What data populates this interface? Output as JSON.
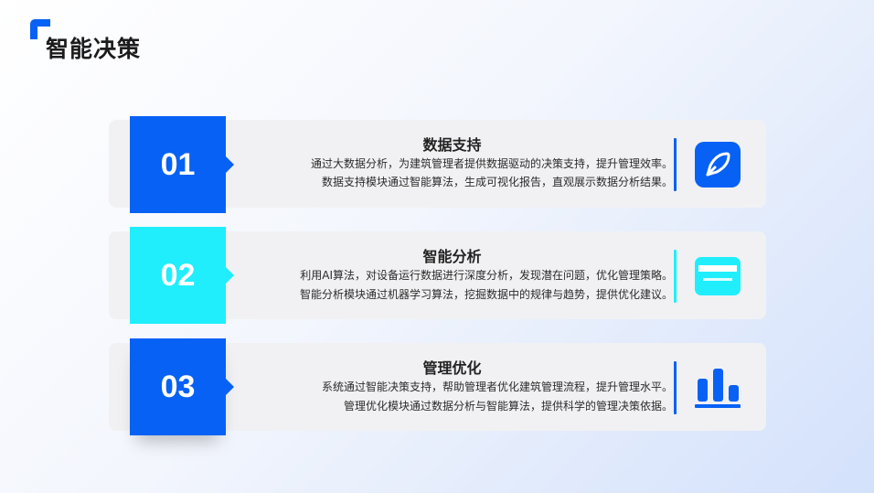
{
  "header": {
    "title": "智能决策"
  },
  "colors": {
    "blue": "#0761f5",
    "cyan": "#20eefd",
    "card_bg": "#f1f1f3"
  },
  "items": [
    {
      "number": "01",
      "title": "数据支持",
      "lines": [
        "通过大数据分析，为建筑管理者提供数据驱动的决策支持，提升管理效率。",
        "数据支持模块通过智能算法，生成可视化报告，直观展示数据分析结果。"
      ],
      "icon": "pen-icon",
      "accent": "#0761f5"
    },
    {
      "number": "02",
      "title": "智能分析",
      "lines": [
        "利用AI算法，对设备运行数据进行深度分析，发现潜在问题，优化管理策略。",
        "智能分析模块通过机器学习算法，挖掘数据中的规律与趋势，提供优化建议。"
      ],
      "icon": "card-icon",
      "accent": "#20eefd"
    },
    {
      "number": "03",
      "title": "管理优化",
      "lines": [
        "系统通过智能决策支持，帮助管理者优化建筑管理流程，提升管理水平。",
        "管理优化模块通过数据分析与智能算法，提供科学的管理决策依据。"
      ],
      "icon": "bar-chart-icon",
      "accent": "#0761f5"
    }
  ]
}
